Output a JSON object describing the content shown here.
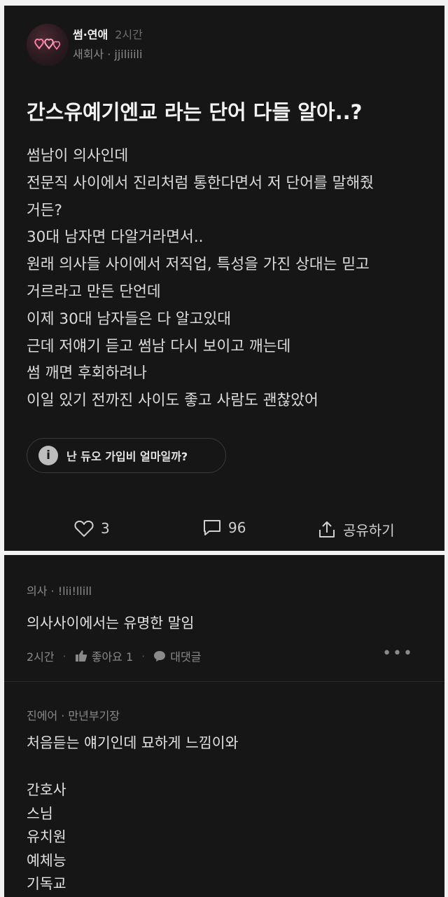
{
  "post": {
    "board": "썸·연애",
    "time": "2시간",
    "author_line": "새회사 · jjiliiili",
    "title": "간스유예기엔교 라는 단어 다들 알아..?",
    "body_lines": [
      "썸남이 의사인데",
      "전문직 사이에서 진리처럼 통한다면서 저 단어를 말해줬",
      "거든?",
      "30대 남자면 다알거라면서..",
      "원래 의사들 사이에서 저직업, 특성을 가진 상대는 믿고",
      "거르라고 만든 단언데",
      "이제 30대 남자들은 다 알고있대",
      "근데 저얘기 듣고 썸남 다시 보이고 깨는데",
      "썸 깨면 후회하려나",
      "이일 있기 전까진 사이도 좋고 사람도 괜찮았어"
    ],
    "chip_icon": "i",
    "chip_text": "난 듀오 가입비 얼마일까?",
    "likes": "3",
    "comments": "96",
    "share_label": "공유하기"
  },
  "comments": [
    {
      "author_line": "의사 · !lii!llill",
      "text_lines": [
        "의사사이에서는 유명한 말임"
      ],
      "time": "2시간",
      "like_label": "좋아요 1",
      "reply_label": "대댓글"
    },
    {
      "author_line": "진에어 · 만년부기장",
      "text_lines": [
        "처음듣는 얘기인데 묘하게 느낌이와",
        "",
        "간호사",
        "스님",
        "유치원",
        "예체능",
        "기독교"
      ]
    }
  ],
  "icons": {
    "avatar": "neon-hearts-icon",
    "like": "heart-icon",
    "comment": "speech-bubble-icon",
    "share": "share-icon",
    "comment_like": "thumbs-up-icon",
    "reply": "chat-bubble-icon",
    "more": "more-dots-icon"
  },
  "colors": {
    "card_bg": "#161616",
    "page_bg": "#f2f2f2",
    "text_primary": "#e6e6e6",
    "text_secondary": "#8a8a8a",
    "avatar_neon": "#ff7fa8"
  }
}
